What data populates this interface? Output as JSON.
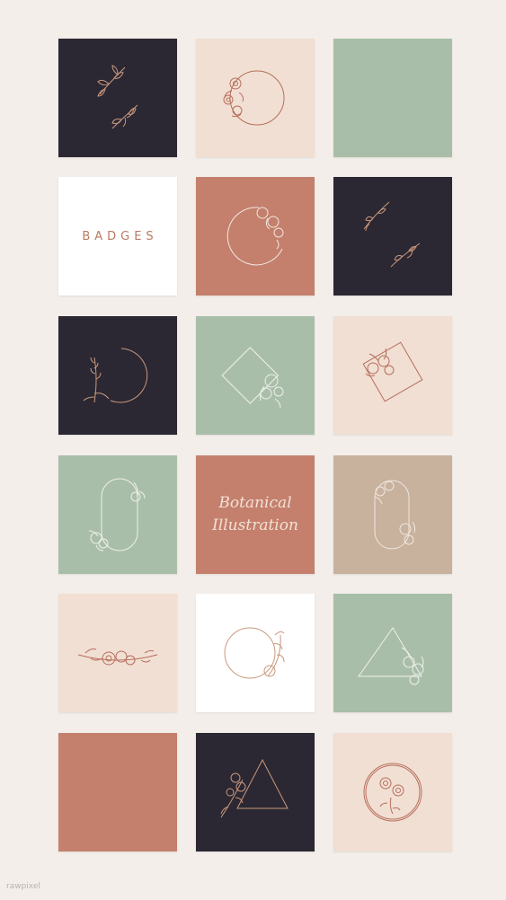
{
  "colors": {
    "page": "#f3eeea",
    "dark": "#2b2833",
    "blush": "#f1dfd3",
    "sage": "#a9bea8",
    "terracotta": "#c4806d",
    "white": "#ffffff",
    "taupe": "#c8b29d",
    "line_gold": "#c9977c",
    "line_rose": "#b76e5c",
    "line_light": "#f0e6df"
  },
  "tiles": [
    {
      "row": 1,
      "col": 1,
      "bg": "dark",
      "motif": "two-sprigs-icon"
    },
    {
      "row": 1,
      "col": 2,
      "bg": "blush",
      "motif": "floral-circle-wreath-icon"
    },
    {
      "row": 1,
      "col": 3,
      "bg": "sage",
      "motif": ""
    },
    {
      "row": 2,
      "col": 1,
      "bg": "white",
      "text": "BADGES"
    },
    {
      "row": 2,
      "col": 2,
      "bg": "terracotta",
      "motif": "floral-crescent-icon"
    },
    {
      "row": 2,
      "col": 3,
      "bg": "dark",
      "motif": "two-sprigs-icon"
    },
    {
      "row": 3,
      "col": 1,
      "bg": "dark",
      "motif": "lavender-circle-icon"
    },
    {
      "row": 3,
      "col": 2,
      "bg": "sage",
      "motif": "floral-diamond-icon"
    },
    {
      "row": 3,
      "col": 3,
      "bg": "blush",
      "motif": "floral-diamond-icon"
    },
    {
      "row": 4,
      "col": 1,
      "bg": "sage",
      "motif": "floral-oval-icon"
    },
    {
      "row": 4,
      "col": 2,
      "bg": "terracotta",
      "text_line1": "Botanical",
      "text_line2": "Illustration"
    },
    {
      "row": 4,
      "col": 3,
      "bg": "taupe",
      "motif": "floral-oval-icon"
    },
    {
      "row": 5,
      "col": 1,
      "bg": "blush",
      "motif": "floral-garland-icon"
    },
    {
      "row": 5,
      "col": 2,
      "bg": "white",
      "motif": "floral-circle-wreath-icon"
    },
    {
      "row": 5,
      "col": 3,
      "bg": "sage",
      "motif": "floral-triangle-icon"
    },
    {
      "row": 6,
      "col": 1,
      "bg": "terracotta",
      "motif": ""
    },
    {
      "row": 6,
      "col": 2,
      "bg": "dark",
      "motif": "floral-triangle-icon"
    },
    {
      "row": 6,
      "col": 3,
      "bg": "blush",
      "motif": "rose-circle-icon"
    }
  ],
  "badges_label": "BADGES",
  "botanical_line1": "Botanical",
  "botanical_line2": "Illustration",
  "watermark": "rawpixel"
}
